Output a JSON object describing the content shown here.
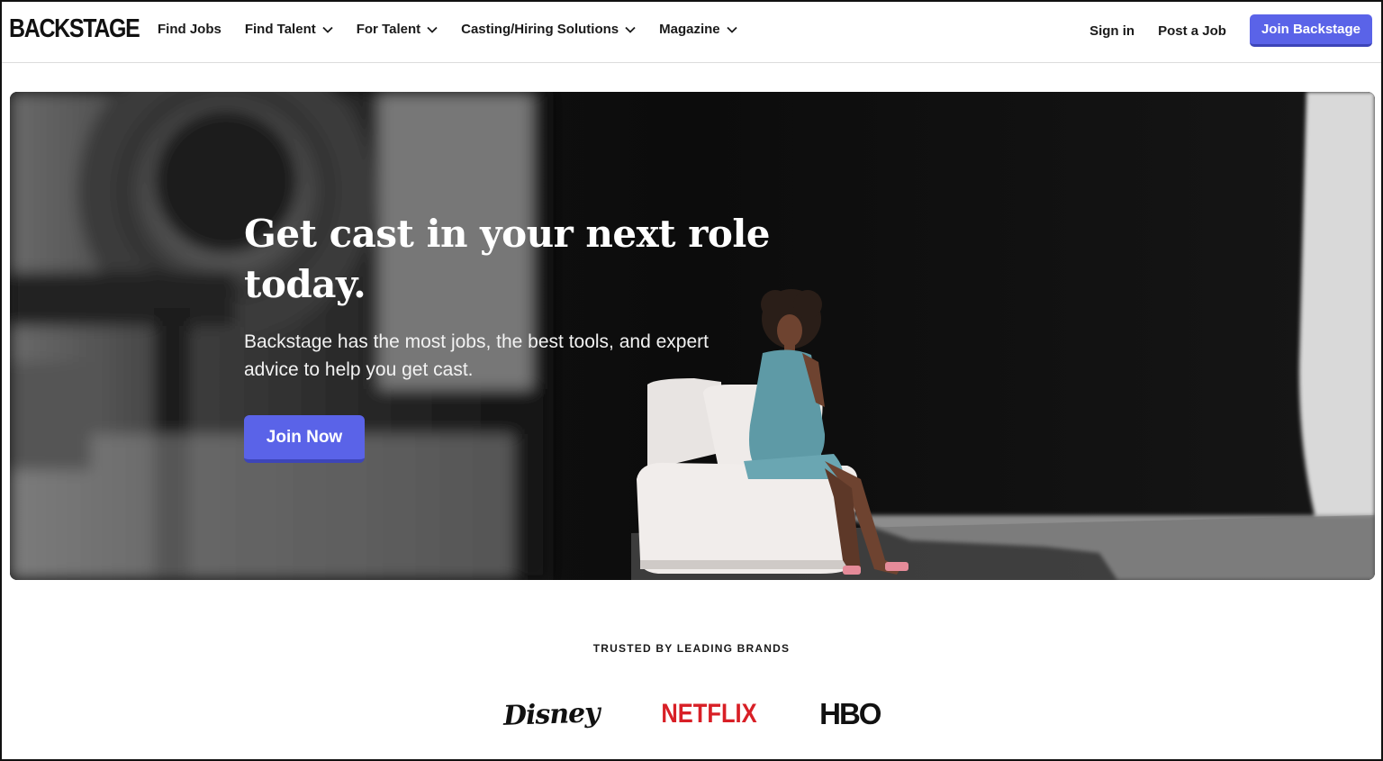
{
  "header": {
    "logo": "BACKSTAGE",
    "nav": [
      {
        "label": "Find Jobs",
        "dropdown": false
      },
      {
        "label": "Find Talent",
        "dropdown": true
      },
      {
        "label": "For Talent",
        "dropdown": true
      },
      {
        "label": "Casting/Hiring Solutions",
        "dropdown": true
      },
      {
        "label": "Magazine",
        "dropdown": true
      }
    ],
    "sign_in": "Sign in",
    "post_job": "Post a Job",
    "join_backstage": "Join Backstage"
  },
  "hero": {
    "title": "Get cast in your next role today.",
    "subtitle": "Backstage has the most jobs, the best tools, and expert advice to help you get cast.",
    "cta": "Join Now"
  },
  "trusted": {
    "heading": "TRUSTED BY LEADING BRANDS",
    "brands": [
      "Disney",
      "NETFLIX",
      "HBO"
    ]
  },
  "colors": {
    "accent": "#5a63e8",
    "netflix_red": "#d81f26"
  }
}
